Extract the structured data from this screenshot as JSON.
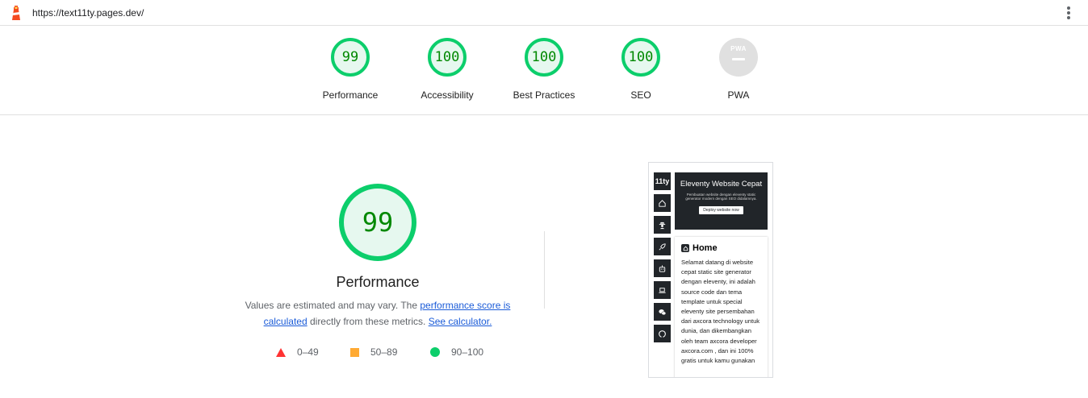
{
  "topbar": {
    "url": "https://text11ty.pages.dev/"
  },
  "categories": [
    {
      "id": "performance",
      "label": "Performance",
      "score": "99"
    },
    {
      "id": "accessibility",
      "label": "Accessibility",
      "score": "100"
    },
    {
      "id": "best-practices",
      "label": "Best Practices",
      "score": "100"
    },
    {
      "id": "seo",
      "label": "SEO",
      "score": "100"
    },
    {
      "id": "pwa",
      "label": "PWA",
      "badge_text": "PWA"
    }
  ],
  "performance": {
    "score": "99",
    "title": "Performance",
    "desc_prefix": "Values are estimated and may vary. The ",
    "link_score": "performance score is calculated",
    "desc_middle": " directly from these metrics. ",
    "link_calc": "See calculator."
  },
  "legend": [
    {
      "range": "0–49",
      "color": "#ff3333",
      "shape": "triangle"
    },
    {
      "range": "50–89",
      "color": "#ffaa33",
      "shape": "square"
    },
    {
      "range": "90–100",
      "color": "#0cce6b",
      "shape": "circle"
    }
  ],
  "screenshot": {
    "sidebar_logo": "11ty",
    "sidebar_icons": [
      "home-icon",
      "user-secret-icon",
      "rocket-icon",
      "robot-icon",
      "laptop-code-icon",
      "wechat-icon",
      "github-icon"
    ],
    "hero_title": "Eleventy Website Cepat",
    "hero_subtitle": "Pembuatan website dengan eleventy static generator modern dengan SEO didalamnya.",
    "hero_button": "Deploy website now",
    "card_title": "Home",
    "card_body": "Selamat datang di website cepat static site generator dengan eleventy, ini adalah source code dan tema template untuk special eleventy site persembahan dari axcora technology untuk dunia, dan dikembangkan oleh team axcora developer axcora.com , dan ini 100% gratis untuk kamu gunakan"
  },
  "colors": {
    "pass": "#0cce6b",
    "pass_text": "#008800",
    "pass_bg": "#e6f8ef",
    "link": "#1a5bd8"
  }
}
